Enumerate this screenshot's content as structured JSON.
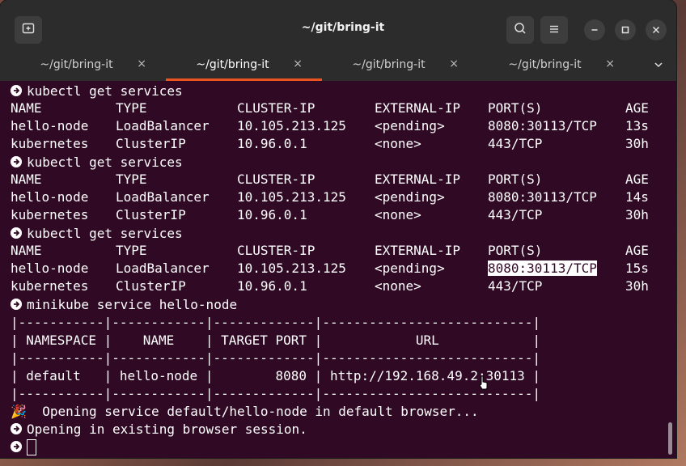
{
  "window": {
    "title": "~/git/bring-it",
    "icons": [
      "new-tab-icon",
      "search-icon",
      "hamburger-menu-icon",
      "minimize-icon",
      "maximize-icon",
      "close-icon",
      "chevron-down-icon"
    ]
  },
  "tabs": [
    {
      "label": "~/git/bring-it",
      "close": "×",
      "active": false
    },
    {
      "label": "~/git/bring-it",
      "close": "×",
      "active": true
    },
    {
      "label": "~/git/bring-it",
      "close": "×",
      "active": false
    },
    {
      "label": "~/git/bring-it",
      "close": "×",
      "active": false
    }
  ],
  "colors": {
    "terminal_bg": "#300a24",
    "accent": "#e95420",
    "titlebar": "#2c2c2c"
  },
  "terminal": {
    "blocks": [
      {
        "command": "kubectl get services",
        "header": [
          "NAME",
          "TYPE",
          "CLUSTER-IP",
          "EXTERNAL-IP",
          "PORT(S)",
          "AGE"
        ],
        "rows": [
          [
            "hello-node",
            "LoadBalancer",
            "10.105.213.125",
            "<pending>",
            "8080:30113/TCP",
            "13s"
          ],
          [
            "kubernetes",
            "ClusterIP",
            "10.96.0.1",
            "<none>",
            "443/TCP",
            "30h"
          ]
        ]
      },
      {
        "command": "kubectl get services",
        "header": [
          "NAME",
          "TYPE",
          "CLUSTER-IP",
          "EXTERNAL-IP",
          "PORT(S)",
          "AGE"
        ],
        "rows": [
          [
            "hello-node",
            "LoadBalancer",
            "10.105.213.125",
            "<pending>",
            "8080:30113/TCP",
            "14s"
          ],
          [
            "kubernetes",
            "ClusterIP",
            "10.96.0.1",
            "<none>",
            "443/TCP",
            "30h"
          ]
        ]
      },
      {
        "command": "kubectl get services",
        "header": [
          "NAME",
          "TYPE",
          "CLUSTER-IP",
          "EXTERNAL-IP",
          "PORT(S)",
          "AGE"
        ],
        "rows": [
          [
            "hello-node",
            "LoadBalancer",
            "10.105.213.125",
            "<pending>",
            "8080:30113/TCP",
            "15s"
          ],
          [
            "kubernetes",
            "ClusterIP",
            "10.96.0.1",
            "<none>",
            "443/TCP",
            "30h"
          ]
        ]
      }
    ],
    "minikube_command": "minikube service hello-node",
    "ascii_table": [
      "|-----------|------------|-------------|---------------------------|",
      "| NAMESPACE |    NAME    | TARGET PORT |            URL            |",
      "|-----------|------------|-------------|---------------------------|",
      "| default   | hello-node |        8080 | http://192.168.49.2:30113 |",
      "|-----------|------------|-------------|---------------------------|"
    ],
    "opening_emoji": "🎉",
    "opening_text": "  Opening service default/hello-node in default browser...",
    "existing_session": "Opening in existing browser session."
  }
}
